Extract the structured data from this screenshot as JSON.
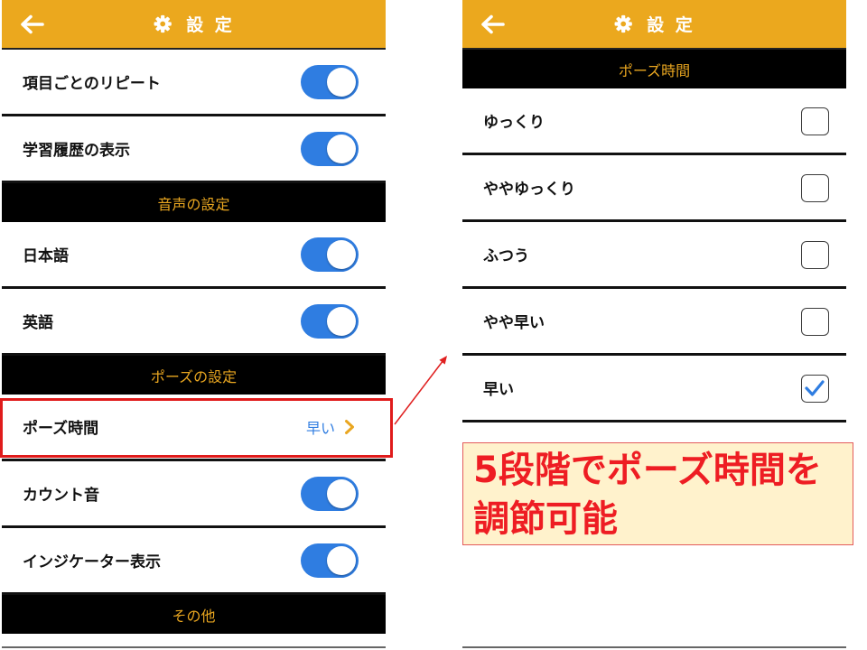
{
  "colors": {
    "header_bg": "#EBA81E",
    "section_text": "#E9A620",
    "toggle_on": "#2F7DE1",
    "value_text": "#2F7DE1",
    "chevron": "#E9A620",
    "check": "#2F7DE1",
    "highlight_border": "#E01B1B",
    "callout_bg": "#FFF2CC",
    "callout_border": "#E35B5B",
    "callout_text": "#EE1D23"
  },
  "left_screen": {
    "header": {
      "back_icon": "arrow-left-icon",
      "settings_icon": "gear-icon",
      "title": "設 定"
    },
    "general": {
      "repeat_each_item": {
        "label": "項目ごとのリピート",
        "on": true
      },
      "show_history": {
        "label": "学習履歴の表示",
        "on": true
      }
    },
    "audio_section": {
      "title": "音声の設定",
      "japanese": {
        "label": "日本語",
        "on": true
      },
      "english": {
        "label": "英語",
        "on": true
      }
    },
    "pause_section": {
      "title": "ポーズの設定",
      "pause_time": {
        "label": "ポーズ時間",
        "value": "早い",
        "icon": "chevron-right-icon"
      },
      "count_sound": {
        "label": "カウント音",
        "on": true
      },
      "indicator": {
        "label": "インジケーター表示",
        "on": true
      }
    },
    "other_section": {
      "title": "その他"
    }
  },
  "right_screen": {
    "header": {
      "back_icon": "arrow-left-icon",
      "settings_icon": "gear-icon",
      "title": "設 定"
    },
    "section_title": "ポーズ時間",
    "options": [
      {
        "label": "ゆっくり",
        "checked": false
      },
      {
        "label": "ややゆっくり",
        "checked": false
      },
      {
        "label": "ふつう",
        "checked": false
      },
      {
        "label": "やや早い",
        "checked": false
      },
      {
        "label": "早い",
        "checked": true
      }
    ]
  },
  "annotation": {
    "callout_lines": [
      "5段階でポーズ時間を",
      "調節可能"
    ]
  }
}
